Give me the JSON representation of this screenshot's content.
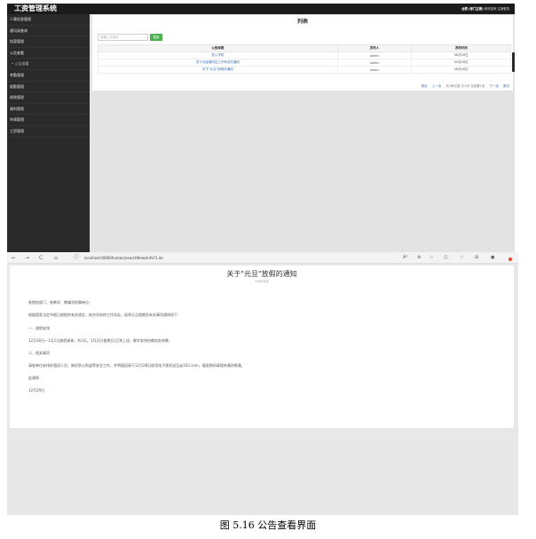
{
  "app": {
    "title": "工资管理系统",
    "header_user": "合肥 (部门主管)",
    "header_links": "修改密码 注销登录"
  },
  "sidebar": {
    "items": [
      {
        "label": "人事信息管理",
        "sub": false
      },
      {
        "label": "通讯录查询",
        "sub": false
      },
      {
        "label": "档案管理",
        "sub": false
      },
      {
        "label": "公告查看",
        "sub": false
      },
      {
        "label": "公告查看",
        "sub": true
      },
      {
        "label": "考勤管理",
        "sub": false
      },
      {
        "label": "假勤管理",
        "sub": false
      },
      {
        "label": "绩效管理",
        "sub": false
      },
      {
        "label": "福利管理",
        "sub": false
      },
      {
        "label": "申请管理",
        "sub": false
      },
      {
        "label": "工资管理",
        "sub": false
      }
    ]
  },
  "list": {
    "title": "列表",
    "search_placeholder": "搜输入关键字",
    "search_button": "搜索",
    "columns": [
      "公告标题",
      "发布人",
      "发布时间"
    ],
    "rows": [
      {
        "title": "放入学校",
        "publisher": "admin",
        "time": "06月26日"
      },
      {
        "title": "关于对疫情防控工作有关的通知",
        "publisher": "admin",
        "time": "05月26日"
      },
      {
        "title": "关于\"元旦\"放假的通知",
        "publisher": "admin",
        "time": "06月26日"
      }
    ],
    "pager": {
      "first": "首页",
      "prev": "上一页",
      "info": "共3条记录 共1页 当前第1页",
      "next": "下一页",
      "last": "尾页"
    }
  },
  "browser": {
    "url": "localhost:8080/human/searchNewsInfo?1.do",
    "nav": {
      "back": "←",
      "forward": "→",
      "reload": "C",
      "home": "⌂",
      "info": "ⓘ"
    },
    "toolbar_glyphs": {
      "read": "Aᴬ",
      "zoom": "⊕",
      "ext": "☆",
      "split": "◫",
      "fav": "☆",
      "collections": "⊞",
      "profile": "●"
    }
  },
  "notice": {
    "title": "关于\"元旦\"放假的通知",
    "date": "06月26日",
    "paragraphs": [
      "各院校部门、各教学、教辅及附属单位:",
      "根据国家法定节假日放假的有关规定，结合学校的工作实际，现将元旦假期及有关事项通知如下:",
      "一、放假安排",
      "12月30日—1月1日放假调休，共3天。1月2日(星期日)正常上班，教学安排由教务处统筹。",
      "二、相关事项",
      "请各单位安排好值班人员，做好防火防盗等安全工作，并将值班表于12月28日前用电子版发送至@163.com，值班期间请保持通讯畅通。",
      "此通知",
      "12月29日"
    ]
  },
  "caption": "图 5.16 公告查看界面"
}
